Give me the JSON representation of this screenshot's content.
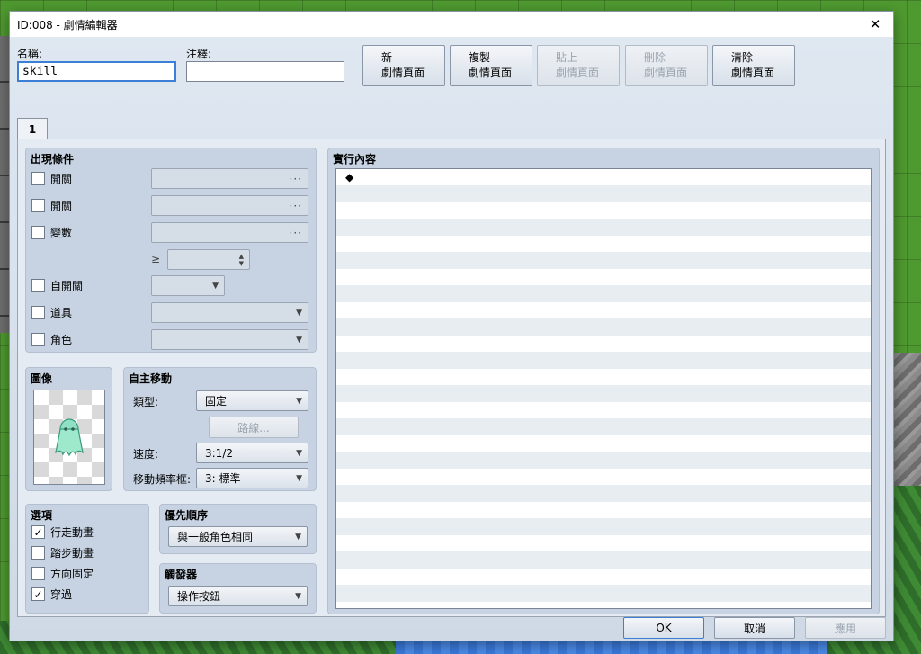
{
  "window": {
    "title": "ID:008 - 劇情編輯器"
  },
  "header": {
    "name_label": "名稱:",
    "name_value": "skill",
    "note_label": "注釋:",
    "note_value": ""
  },
  "page_buttons": [
    {
      "line1": "新",
      "line2": "劇情頁面",
      "enabled": true
    },
    {
      "line1": "複製",
      "line2": "劇情頁面",
      "enabled": true
    },
    {
      "line1": "貼上",
      "line2": "劇情頁面",
      "enabled": false
    },
    {
      "line1": "刪除",
      "line2": "劇情頁面",
      "enabled": false
    },
    {
      "line1": "清除",
      "line2": "劇情頁面",
      "enabled": true
    }
  ],
  "tab": {
    "label": "1"
  },
  "conditions": {
    "title": "出現條件",
    "switch1_label": "開關",
    "switch2_label": "開關",
    "variable_label": "變數",
    "gte_symbol": "≥",
    "self_switch_label": "自開關",
    "item_label": "道具",
    "actor_label": "角色"
  },
  "image": {
    "title": "圖像"
  },
  "movement": {
    "title": "自主移動",
    "type_label": "類型:",
    "type_value": "固定",
    "route_button": "路線...",
    "speed_label": "速度:",
    "speed_value": "3:1/2",
    "freq_label": "移動頻率框:",
    "freq_value": "3: 標準"
  },
  "options": {
    "title": "選項",
    "walking_label": "行走動畫",
    "walking_checked": true,
    "stepping_label": "踏步動畫",
    "stepping_checked": false,
    "direction_fix_label": "方向固定",
    "direction_fix_checked": false,
    "through_label": "穿過",
    "through_checked": true
  },
  "priority": {
    "title": "優先順序",
    "value": "與一般角色相同"
  },
  "trigger": {
    "title": "觸發器",
    "value": "操作按鈕"
  },
  "contents": {
    "title": "實行內容",
    "first_row": "◆"
  },
  "footer": {
    "ok": "OK",
    "cancel": "取消",
    "apply": "應用"
  },
  "icons": {
    "check": "✓",
    "dropdown": "▼",
    "ellipsis": "···",
    "spin_up": "▲",
    "spin_down": "▼",
    "close": "✕"
  }
}
